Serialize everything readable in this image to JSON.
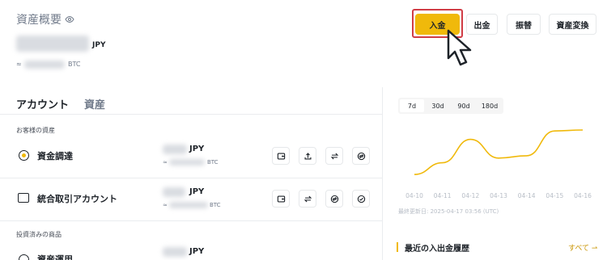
{
  "header": {
    "title": "資産概要",
    "currency": "JPY",
    "btc_prefix": "≈",
    "btc_currency": "BTC"
  },
  "actions": {
    "deposit": "入金",
    "withdraw": "出金",
    "transfer": "振替",
    "convert": "資産変換"
  },
  "tabs": {
    "account": "アカウント",
    "assets": "資産"
  },
  "sections": {
    "customer_assets": "お客様の資産",
    "investment_products": "投資済みの商品"
  },
  "rows": [
    {
      "name": "資金調達",
      "currency": "JPY",
      "btc_prefix": "≈",
      "btc_currency": "BTC"
    },
    {
      "name": "統合取引アカウント",
      "currency": "JPY",
      "btc_prefix": "≈",
      "btc_currency": "BTC"
    },
    {
      "name": "資産運用",
      "currency": "JPY"
    }
  ],
  "chart": {
    "ranges": [
      "7d",
      "30d",
      "90d",
      "180d"
    ],
    "active_range": "7d",
    "updated": "最終更新日: 2025-04-17 03:56 (UTC)",
    "line_color": "#f0b90b"
  },
  "chart_data": {
    "type": "line",
    "categories": [
      "04-10",
      "04-11",
      "04-12",
      "04-13",
      "04-14",
      "04-15",
      "04-16"
    ],
    "series": [
      {
        "values": [
          0.05,
          0.3,
          0.8,
          0.4,
          0.45,
          0.98,
          1.0
        ]
      }
    ],
    "ylim": [
      0,
      1
    ]
  },
  "recent": {
    "title": "最近の入出金履歴",
    "see_all": "すべて ⇀"
  },
  "colors": {
    "accent": "#f0b90b",
    "highlight_frame": "#d03c46"
  }
}
